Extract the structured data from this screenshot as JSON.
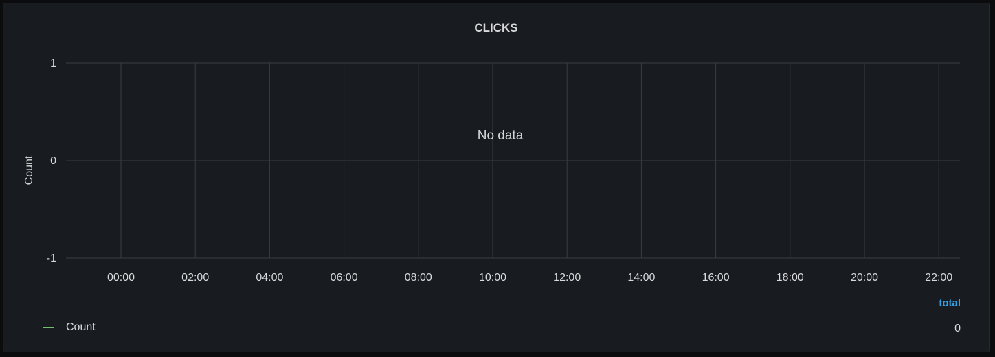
{
  "chart_data": {
    "type": "line",
    "title": "CLICKS",
    "ylabel": "Count",
    "xlabel": "",
    "ylim": [
      -1,
      1
    ],
    "y_ticks": [
      {
        "value": 1,
        "label": "1"
      },
      {
        "value": 0,
        "label": "0"
      },
      {
        "value": -1,
        "label": "-1"
      }
    ],
    "x_ticks": [
      "00:00",
      "02:00",
      "04:00",
      "06:00",
      "08:00",
      "10:00",
      "12:00",
      "14:00",
      "16:00",
      "18:00",
      "20:00",
      "22:00"
    ],
    "series": [
      {
        "name": "Count",
        "values": [],
        "color": "#73bf69"
      }
    ],
    "no_data_message": "No data",
    "grid": true,
    "legend_placement": "bottom"
  },
  "legend": {
    "column_header": "total",
    "items": [
      {
        "label": "Count",
        "total": "0",
        "color": "#73bf69"
      }
    ]
  },
  "colors": {
    "background": "#181b1f",
    "grid": "#3a3d42",
    "text": "#d8d9da",
    "accent": "#33a2e5"
  }
}
